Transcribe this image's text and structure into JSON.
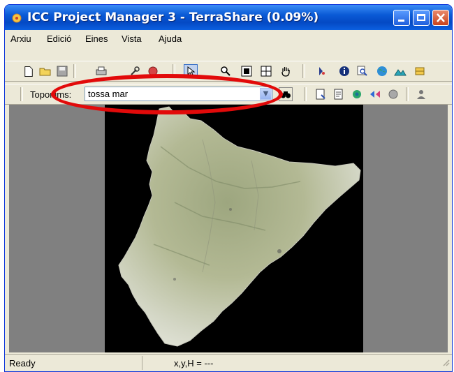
{
  "window": {
    "title": "ICC Project Manager 3 - TerraShare (0.09%)"
  },
  "menu": [
    "Arxiu",
    "Edició",
    "Eines",
    "Vista",
    "Ajuda"
  ],
  "toponims": {
    "label": "Toponims:",
    "value": "tossa mar"
  },
  "status": {
    "left": "Ready",
    "coords": "x,y,H = ---"
  },
  "colors": {
    "titlebar": "#0a5ad6",
    "highlight": "#e20a0a",
    "map_background": "#000000",
    "gray_background": "#808080"
  }
}
